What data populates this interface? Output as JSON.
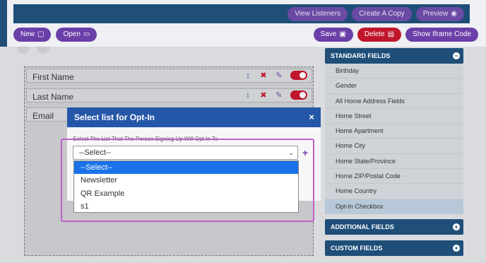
{
  "header": {
    "buttons": [
      {
        "label": "View Listeners"
      },
      {
        "label": "Create A Copy"
      },
      {
        "label": "Preview"
      }
    ]
  },
  "toolbar": {
    "new_label": "New",
    "open_label": "Open",
    "save_label": "Save",
    "delete_label": "Delete",
    "iframe_label": "Show Iframe Code"
  },
  "form_fields": [
    {
      "label": "First Name"
    },
    {
      "label": "Last Name"
    },
    {
      "label": "Email"
    }
  ],
  "sidebar": {
    "standard_title": "STANDARD FIELDS",
    "items": [
      "Birthday",
      "Gender",
      "All Home Address Fields",
      "Home Street",
      "Home Apartment",
      "Home City",
      "Home State/Province",
      "Home ZIP/Postal Code",
      "Home Country",
      "Opt-In Checkbox"
    ],
    "additional_title": "ADDITIONAL FIELDS",
    "custom_title": "CUSTOM FIELDS"
  },
  "modal": {
    "title": "Select list for Opt-In",
    "close": "×",
    "description": "Select The List That The Person Signing Up Will Opt In To",
    "select_value": "--Select--",
    "add": "+",
    "options": [
      "--Select--",
      "Newsletter",
      "QR Example",
      "s1"
    ]
  },
  "colors": {
    "header_blue": "#1f4e79",
    "modal_blue": "#2557a8",
    "purple": "#6b3fa8",
    "delete_red": "#c0162c",
    "highlight": "#c05fc9",
    "selected_option": "#1a73e8"
  }
}
